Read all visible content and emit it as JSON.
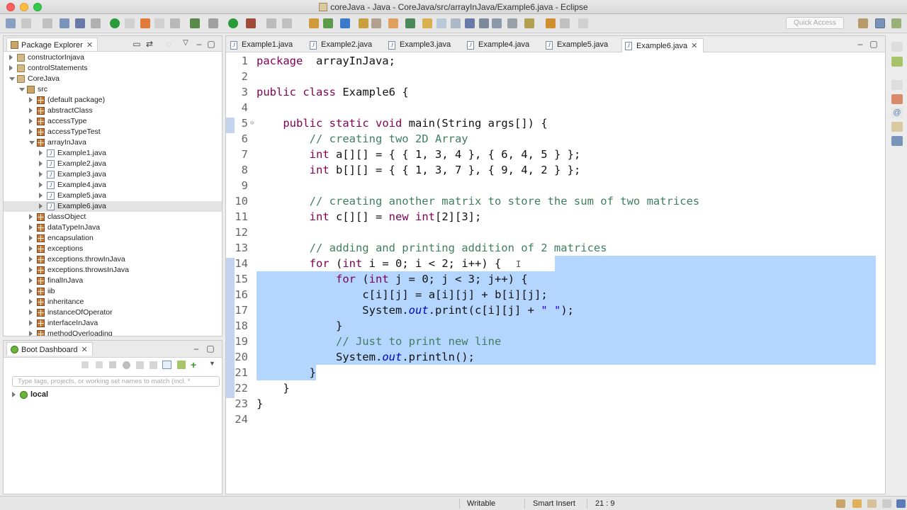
{
  "window": {
    "title": "coreJava - Java - CoreJava/src/arrayInJava/Example6.java - Eclipse"
  },
  "toolbar": {
    "quick_access": "Quick Access"
  },
  "package_explorer": {
    "title": "Package Explorer",
    "items": [
      {
        "label": "constructorInjava",
        "type": "proj",
        "depth": 0,
        "expanded": false
      },
      {
        "label": "controlStatements",
        "type": "proj",
        "depth": 0,
        "expanded": false
      },
      {
        "label": "CoreJava",
        "type": "proj",
        "depth": 0,
        "expanded": true
      },
      {
        "label": "src",
        "type": "src",
        "depth": 1,
        "expanded": true
      },
      {
        "label": "(default package)",
        "type": "pkg",
        "depth": 2,
        "expanded": false
      },
      {
        "label": "abstractClass",
        "type": "pkg",
        "depth": 2,
        "expanded": false
      },
      {
        "label": "accessType",
        "type": "pkg",
        "depth": 2,
        "expanded": false
      },
      {
        "label": "accessTypeTest",
        "type": "pkg",
        "depth": 2,
        "expanded": false
      },
      {
        "label": "arrayInJava",
        "type": "pkg",
        "depth": 2,
        "expanded": true
      },
      {
        "label": "Example1.java",
        "type": "java",
        "depth": 3,
        "expanded": false
      },
      {
        "label": "Example2.java",
        "type": "java",
        "depth": 3,
        "expanded": false
      },
      {
        "label": "Example3.java",
        "type": "java",
        "depth": 3,
        "expanded": false
      },
      {
        "label": "Example4.java",
        "type": "java",
        "depth": 3,
        "expanded": false
      },
      {
        "label": "Example5.java",
        "type": "java",
        "depth": 3,
        "expanded": false
      },
      {
        "label": "Example6.java",
        "type": "java",
        "depth": 3,
        "expanded": false,
        "selected": true
      },
      {
        "label": "classObject",
        "type": "pkg",
        "depth": 2,
        "expanded": false
      },
      {
        "label": "dataTypeInJava",
        "type": "pkg",
        "depth": 2,
        "expanded": false
      },
      {
        "label": "encapsulation",
        "type": "pkg",
        "depth": 2,
        "expanded": false
      },
      {
        "label": "exceptions",
        "type": "pkg",
        "depth": 2,
        "expanded": false
      },
      {
        "label": "exceptions.throwInJava",
        "type": "pkg",
        "depth": 2,
        "expanded": false
      },
      {
        "label": "exceptions.throwsInJava",
        "type": "pkg",
        "depth": 2,
        "expanded": false
      },
      {
        "label": "finalInJava",
        "type": "pkg",
        "depth": 2,
        "expanded": false
      },
      {
        "label": "iib",
        "type": "pkg",
        "depth": 2,
        "expanded": false
      },
      {
        "label": "inheritance",
        "type": "pkg",
        "depth": 2,
        "expanded": false
      },
      {
        "label": "instanceOfOperator",
        "type": "pkg",
        "depth": 2,
        "expanded": false
      },
      {
        "label": "interfaceInJava",
        "type": "pkg",
        "depth": 2,
        "expanded": false
      },
      {
        "label": "methodOverloading",
        "type": "pkg",
        "depth": 2,
        "expanded": false
      }
    ]
  },
  "boot_dashboard": {
    "title": "Boot Dashboard",
    "filter_placeholder": "Type tags, projects, or working set names to match (incl. *",
    "local_label": "local"
  },
  "editor": {
    "tabs": [
      {
        "label": "Example1.java",
        "active": false
      },
      {
        "label": "Example2.java",
        "active": false
      },
      {
        "label": "Example3.java",
        "active": false
      },
      {
        "label": "Example4.java",
        "active": false
      },
      {
        "label": "Example5.java",
        "active": false
      },
      {
        "label": "Example6.java",
        "active": true
      }
    ],
    "lines": [
      {
        "n": "1",
        "tokens": [
          [
            "kw",
            "package"
          ],
          [
            "",
            "  arrayInJava;"
          ]
        ]
      },
      {
        "n": "2",
        "tokens": []
      },
      {
        "n": "3",
        "tokens": [
          [
            "kw",
            "public"
          ],
          [
            "",
            " "
          ],
          [
            "kw",
            "class"
          ],
          [
            "",
            " Example6 {"
          ]
        ]
      },
      {
        "n": "4",
        "tokens": []
      },
      {
        "n": "5",
        "fold": true,
        "tokens": [
          [
            "",
            "    "
          ],
          [
            "kw",
            "public"
          ],
          [
            "",
            " "
          ],
          [
            "kw",
            "static"
          ],
          [
            "",
            " "
          ],
          [
            "kw",
            "void"
          ],
          [
            "",
            " main(String "
          ],
          [
            "param",
            "args"
          ],
          [
            "",
            "[]) {"
          ]
        ]
      },
      {
        "n": "6",
        "tokens": [
          [
            "",
            "        "
          ],
          [
            "cm",
            "// creating two 2D Array"
          ]
        ]
      },
      {
        "n": "7",
        "tokens": [
          [
            "",
            "        "
          ],
          [
            "kw",
            "int"
          ],
          [
            "",
            " "
          ],
          [
            "param",
            "a"
          ],
          [
            "",
            "[][] = { { 1, 3, 4 }, { 6, 4, 5 } };"
          ]
        ]
      },
      {
        "n": "8",
        "tokens": [
          [
            "",
            "        "
          ],
          [
            "kw",
            "int"
          ],
          [
            "",
            " "
          ],
          [
            "param",
            "b"
          ],
          [
            "",
            "[][] = { { 1, 3, 7 }, { 9, 4, 2 } };"
          ]
        ]
      },
      {
        "n": "9",
        "tokens": []
      },
      {
        "n": "10",
        "tokens": [
          [
            "",
            "        "
          ],
          [
            "cm",
            "// creating another matrix to store the sum of two matrices"
          ]
        ]
      },
      {
        "n": "11",
        "tokens": [
          [
            "",
            "        "
          ],
          [
            "kw",
            "int"
          ],
          [
            "",
            " "
          ],
          [
            "param",
            "c"
          ],
          [
            "",
            "[][] = "
          ],
          [
            "kw",
            "new"
          ],
          [
            "",
            " "
          ],
          [
            "kw",
            "int"
          ],
          [
            "",
            "[2][3];"
          ]
        ]
      },
      {
        "n": "12",
        "tokens": []
      },
      {
        "n": "13",
        "tokens": [
          [
            "",
            "        "
          ],
          [
            "cm",
            "// adding and printing addition of 2 matrices"
          ]
        ]
      },
      {
        "n": "14",
        "tokens": [
          [
            "",
            "        "
          ],
          [
            "kw",
            "for"
          ],
          [
            "",
            " ("
          ],
          [
            "kw",
            "int"
          ],
          [
            "",
            " "
          ],
          [
            "param",
            "i"
          ],
          [
            "",
            " = 0; "
          ],
          [
            "param",
            "i"
          ],
          [
            "",
            " < 2; "
          ],
          [
            "param",
            "i"
          ],
          [
            "",
            "++) {"
          ]
        ]
      },
      {
        "n": "15",
        "tokens": [
          [
            "",
            "            "
          ],
          [
            "kw",
            "for"
          ],
          [
            "",
            " ("
          ],
          [
            "kw",
            "int"
          ],
          [
            "",
            " "
          ],
          [
            "param",
            "j"
          ],
          [
            "",
            " = 0; "
          ],
          [
            "param",
            "j"
          ],
          [
            "",
            " < 3; "
          ],
          [
            "param",
            "j"
          ],
          [
            "",
            "++) {"
          ]
        ]
      },
      {
        "n": "16",
        "tokens": [
          [
            "",
            "                "
          ],
          [
            "param",
            "c"
          ],
          [
            "",
            "["
          ],
          [
            "param",
            "i"
          ],
          [
            "",
            "]["
          ],
          [
            "param",
            "j"
          ],
          [
            "",
            "] = "
          ],
          [
            "param",
            "a"
          ],
          [
            "",
            "["
          ],
          [
            "param",
            "i"
          ],
          [
            "",
            "]["
          ],
          [
            "param",
            "j"
          ],
          [
            "",
            "] + "
          ],
          [
            "param",
            "b"
          ],
          [
            "",
            "["
          ],
          [
            "param",
            "i"
          ],
          [
            "",
            "]["
          ],
          [
            "param",
            "j"
          ],
          [
            "",
            "];"
          ]
        ]
      },
      {
        "n": "17",
        "tokens": [
          [
            "",
            "                System."
          ],
          [
            "sfld",
            "out"
          ],
          [
            "",
            ".print("
          ],
          [
            "param",
            "c"
          ],
          [
            "",
            "["
          ],
          [
            "param",
            "i"
          ],
          [
            "",
            "]["
          ],
          [
            "param",
            "j"
          ],
          [
            "",
            "] + "
          ],
          [
            "str",
            "\" \""
          ],
          [
            "",
            ");"
          ]
        ]
      },
      {
        "n": "18",
        "tokens": [
          [
            "",
            "            }"
          ]
        ]
      },
      {
        "n": "19",
        "tokens": [
          [
            "",
            "            "
          ],
          [
            "cm",
            "// Just to print new line"
          ]
        ]
      },
      {
        "n": "20",
        "tokens": [
          [
            "",
            "            System."
          ],
          [
            "sfld",
            "out"
          ],
          [
            "",
            ".println();"
          ]
        ]
      },
      {
        "n": "21",
        "tokens": [
          [
            "",
            "        }"
          ]
        ]
      },
      {
        "n": "22",
        "tokens": [
          [
            "",
            "    }"
          ]
        ]
      },
      {
        "n": "23",
        "tokens": [
          [
            "",
            "}"
          ]
        ]
      },
      {
        "n": "24",
        "tokens": []
      }
    ]
  },
  "statusbar": {
    "writable": "Writable",
    "insert_mode": "Smart Insert",
    "position": "21 : 9"
  }
}
